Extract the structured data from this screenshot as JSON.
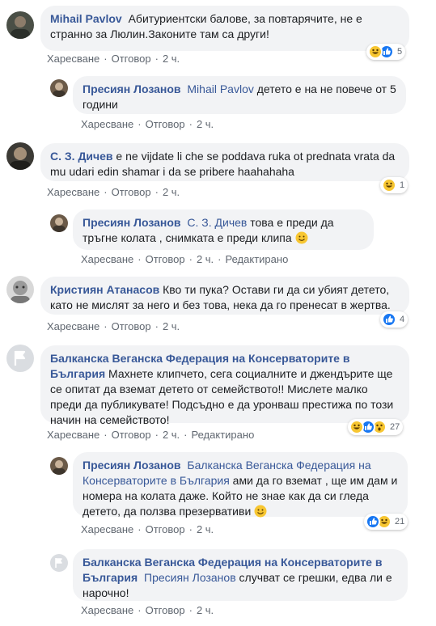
{
  "actions": {
    "like": "Харесване",
    "reply": "Отговор",
    "time": "2 ч.",
    "edited": "Редактирано"
  },
  "comments": [
    {
      "author": "Mihail Pavlov",
      "text": "Абитуриентски балове, за повтарячите, не е странно за Люлин.Законите там са други!",
      "reaction_count": "5",
      "replies": [
        {
          "author": "Пресиян Лозанов",
          "mention": "Mihail Pavlov",
          "text": " детето е на не повече от 5 години"
        }
      ]
    },
    {
      "author": "С. З. Дичев",
      "text": " e ne vijdate li che se poddava ruka ot prednata vrata da mu udari edin shamar i da se pribere haahahaha",
      "reaction_count": "1",
      "replies": [
        {
          "author": "Пресиян Лозанов",
          "mention": "С. З. Дичев",
          "text": " това е преди да тръгне колата , снимката е преди клипа"
        }
      ]
    },
    {
      "author": "Кристиян Атанасов",
      "text": " Кво ти пука? Остави ги да си убият детето, като не мислят за него и без това, нека да го пренесат в жертва.",
      "reaction_count": "4"
    },
    {
      "author": "Балканска Веганска Федерация на Консерваторите в България",
      "text": " Махнете клипчето, сега социалните и джендърите ще се опитат да вземат детето от семейството!! Мислете малко преди да публикувате! Подсъдно е да уронваш престижа по този начин на семейството!",
      "reaction_count": "27",
      "replies": [
        {
          "author": "Пресиян Лозанов",
          "mention": "Балканска Веганска Федерация на Консерваторите в България",
          "text": " ами да го вземат , ще им дам и номера на колата даже. Който не знае как да си гледа детето, да ползва презервативи",
          "reaction_count": "21"
        },
        {
          "author": "Балканска Веганска Федерация на Консерваторите в България",
          "mention": "Пресиян Лозанов",
          "text": " случват се грешки, едва ли е нарочно!"
        }
      ]
    }
  ],
  "colors": {
    "link": "#385898",
    "bubble": "#f2f3f5",
    "meta": "#606770",
    "like_blue": "#1877f2",
    "haha_yellow": "#f7c631"
  }
}
